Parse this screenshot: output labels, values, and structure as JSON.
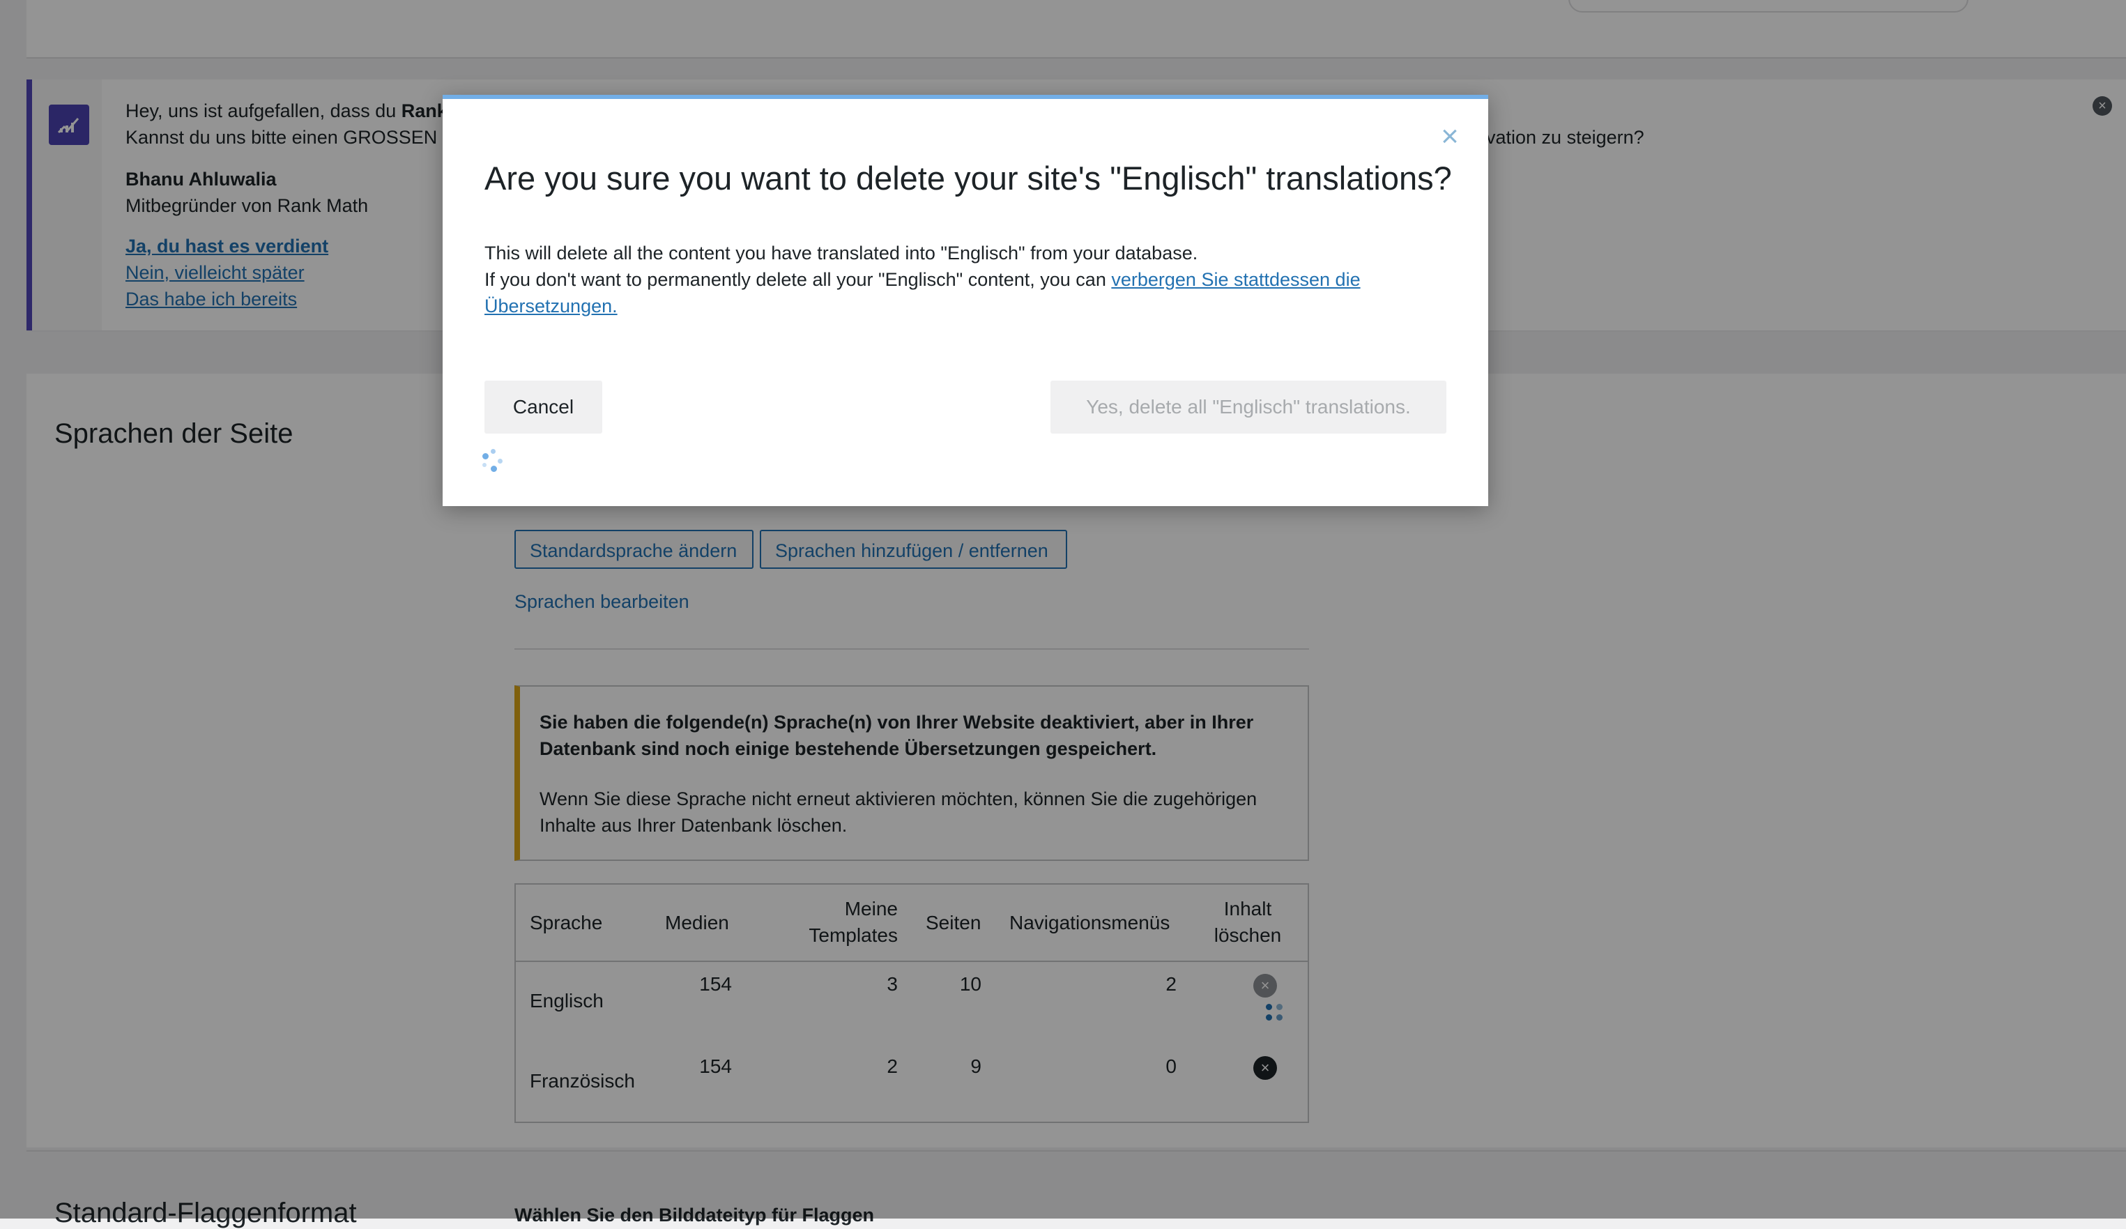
{
  "notice": {
    "line1_prefix": "Hey, uns ist aufgefallen, dass du ",
    "line1_bold": "Rank",
    "line1_tail": "vation zu steigern?",
    "line2_prefix": "Kannst du uns bitte einen GROSSEN C",
    "author_name": "Bhanu Ahluwalia",
    "author_role": "Mitbegründer von Rank Math",
    "link_yes": "Ja, du hast es verdient",
    "link_later": "Nein, vielleicht später",
    "link_already": "Das habe ich bereits",
    "close_icon": "×"
  },
  "settings": {
    "section_title": "Sprachen der Seite",
    "btn_change_default": "Standardsprache ändern",
    "btn_add_remove": "Sprachen hinzufügen / entfernen",
    "link_edit": "Sprachen bearbeiten",
    "warning_bold_1": "Sie haben die folgende(n) Sprache(n) von Ihrer Website deaktiviert, aber in Ihrer",
    "warning_bold_2": "Datenbank sind noch einige bestehende Übersetzungen gespeichert.",
    "warning_text_1": "Wenn Sie diese Sprache nicht erneut aktivieren möchten, können Sie die zugehörigen",
    "warning_text_2": "Inhalte aus Ihrer Datenbank löschen.",
    "table": {
      "headers": {
        "sprache": "Sprache",
        "medien": "Medien",
        "templates_1": "Meine",
        "templates_2": "Templates",
        "seiten": "Seiten",
        "menus": "Navigationsmenüs",
        "delete_1": "Inhalt",
        "delete_2": "löschen"
      },
      "rows": [
        {
          "sprache": "Englisch",
          "medien": "154",
          "templates": "3",
          "seiten": "10",
          "menus": "2"
        },
        {
          "sprache": "Französisch",
          "medien": "154",
          "templates": "2",
          "seiten": "9",
          "menus": "0"
        }
      ]
    },
    "bottom_title": "Standard-Flaggenformat",
    "bottom_sub": "Wählen Sie den Bilddateityp für Flaggen"
  },
  "modal": {
    "title": "Are you sure you want to delete your site's \"Englisch\" translations?",
    "text_1": "This will delete all the content you have translated into \"Englisch\" from your database.",
    "text_2_prefix": "If you don't want to permanently delete all your \"Englisch\" content, you can ",
    "text_2_link_a": "verbergen Sie stattdessen die",
    "text_2_link_b": "Übersetzungen.",
    "cancel": "Cancel",
    "confirm": "Yes, delete all \"Englisch\" translations.",
    "close_icon": "×"
  },
  "colors": {
    "accent": "#2271b1",
    "notice_border": "#5045b7",
    "warning_border": "#dba617",
    "modal_top_border": "#72aee6"
  }
}
